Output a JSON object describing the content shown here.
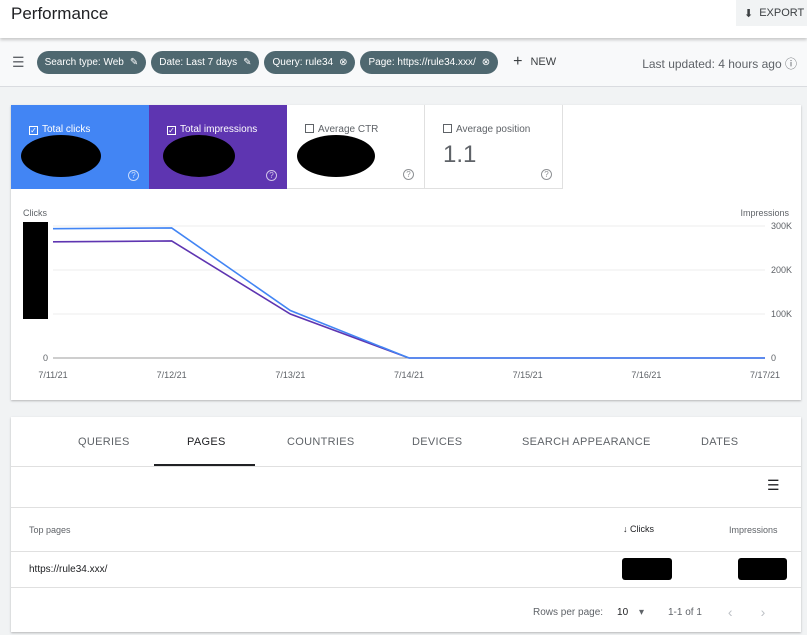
{
  "header": {
    "title": "Performance",
    "export_label": "EXPORT"
  },
  "filters": {
    "chips": [
      "Search type: Web",
      "Date: Last 7 days",
      "Query: rule34",
      "Page: https://rule34.xxx/"
    ],
    "new_label": "NEW",
    "last_updated": "Last updated: 4 hours ago"
  },
  "metrics": [
    {
      "label": "Total clicks",
      "checked": true,
      "color": "#4285f4"
    },
    {
      "label": "Total impressions",
      "checked": true,
      "color": "#5e35b1"
    },
    {
      "label": "Average CTR",
      "checked": false
    },
    {
      "label": "Average position",
      "checked": false,
      "value": "1.1"
    }
  ],
  "chart_data": {
    "type": "line",
    "x": [
      "7/11/21",
      "7/12/21",
      "7/13/21",
      "7/14/21",
      "7/15/21",
      "7/16/21",
      "7/17/21"
    ],
    "series": [
      {
        "name": "Clicks",
        "axis": "left",
        "note": "values as fraction of left axis max (axis labels redacted)",
        "values": [
          0.98,
          0.985,
          0.36,
          0,
          0,
          0,
          0
        ],
        "color": "#4285f4"
      },
      {
        "name": "Impressions",
        "axis": "right",
        "values": [
          264000,
          266000,
          100000,
          0,
          0,
          0,
          0
        ],
        "color": "#5e35b1"
      }
    ],
    "ylabel_left": "Clicks",
    "ylabel_right": "Impressions",
    "left_ticks": [
      "0"
    ],
    "right_ticks": [
      "0",
      "100K",
      "200K",
      "300K"
    ],
    "ylim_right": [
      0,
      300000
    ]
  },
  "table": {
    "tabs": [
      "QUERIES",
      "PAGES",
      "COUNTRIES",
      "DEVICES",
      "SEARCH APPEARANCE",
      "DATES"
    ],
    "active_tab": "PAGES",
    "columns": [
      "Top pages",
      "Clicks",
      "Impressions"
    ],
    "rows": [
      {
        "page": "https://rule34.xxx/"
      }
    ],
    "rows_per_page_label": "Rows per page:",
    "rows_per_page": "10",
    "range": "1-1 of 1"
  }
}
